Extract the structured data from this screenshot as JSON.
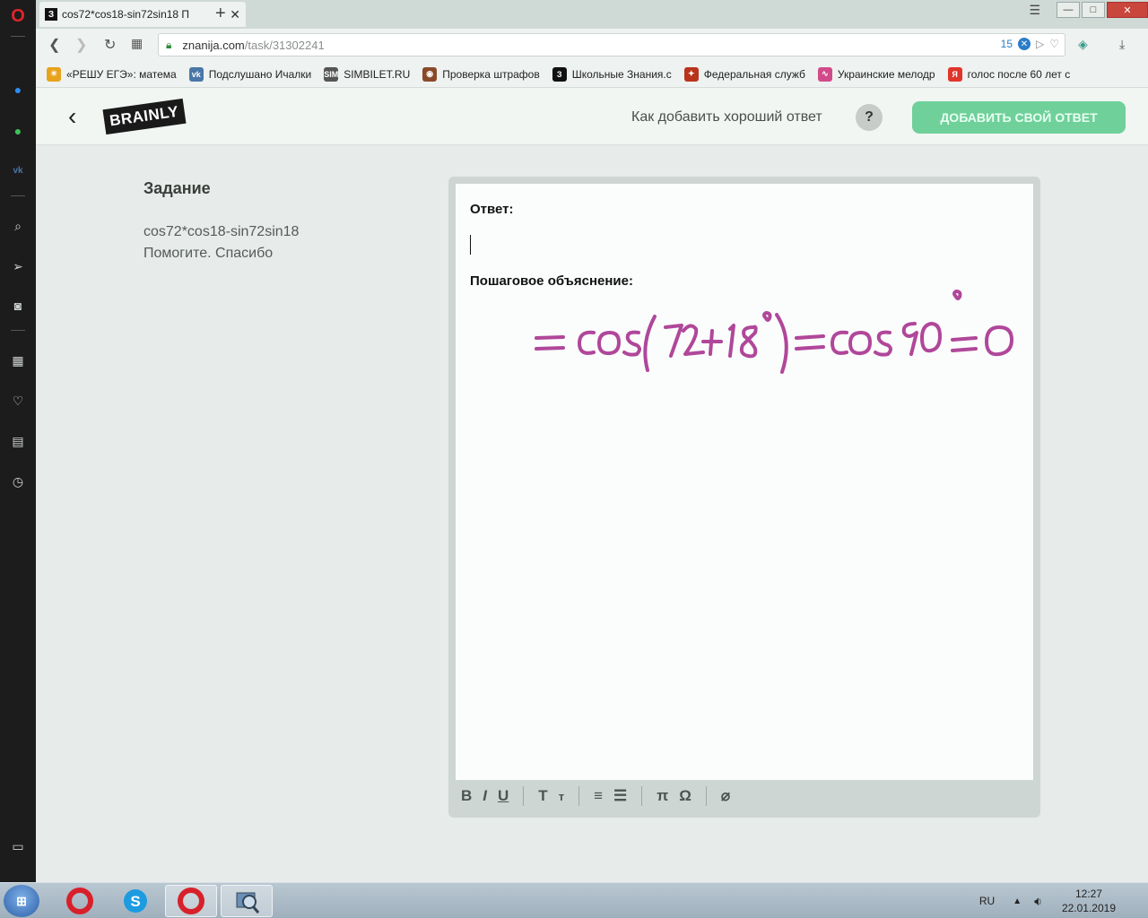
{
  "browser": {
    "tab_title": "cos72*cos18-sin72sin18 П",
    "tab_favicon": "З",
    "url_domain": "znanija.com",
    "url_path": "/task/31302241",
    "adblock_count": "15",
    "win_min": "—",
    "win_max": "□",
    "win_close": "✕"
  },
  "bookmarks": [
    {
      "label": "«РЕШУ ЕГЭ»: матема",
      "color": "#e8a21c",
      "icon": "☀"
    },
    {
      "label": "Подслушано Ичалки",
      "color": "#4a76a8",
      "icon": "vk"
    },
    {
      "label": "SIMBILET.RU",
      "color": "#555555",
      "icon": "SIM"
    },
    {
      "label": "Проверка штрафов",
      "color": "#8a4a2a",
      "icon": "◉"
    },
    {
      "label": "Школьные Знания.с",
      "color": "#111111",
      "icon": "З"
    },
    {
      "label": "Федеральная служб",
      "color": "#b8341c",
      "icon": "✦"
    },
    {
      "label": "Украинские мелодр",
      "color": "#d24a8a",
      "icon": "∿"
    },
    {
      "label": "голос после 60 лет с",
      "color": "#e0352b",
      "icon": "Я"
    }
  ],
  "header": {
    "logo": "BRAINLY",
    "how_to": "Как добавить хороший ответ",
    "help": "?",
    "add_answer": "ДОБАВИТЬ СВОЙ ОТВЕТ"
  },
  "task": {
    "heading": "Задание",
    "line1": "cos72*cos18-sin72sin18",
    "line2": "Помогите. Спасибо"
  },
  "editor": {
    "answer_label": "Ответ:",
    "explanation_label": "Пошаговое объяснение:",
    "handwriting": {
      "text": "=cos(72+18°)=cos 90°=0",
      "ink_color": "#b0479a"
    },
    "toolbar": [
      "B",
      "I",
      "U",
      "T",
      "т",
      "≡",
      "☰",
      "π",
      "Ω",
      "⌀"
    ]
  },
  "taskbar": {
    "lang": "RU",
    "time": "12:27",
    "date": "22.01.2019"
  }
}
